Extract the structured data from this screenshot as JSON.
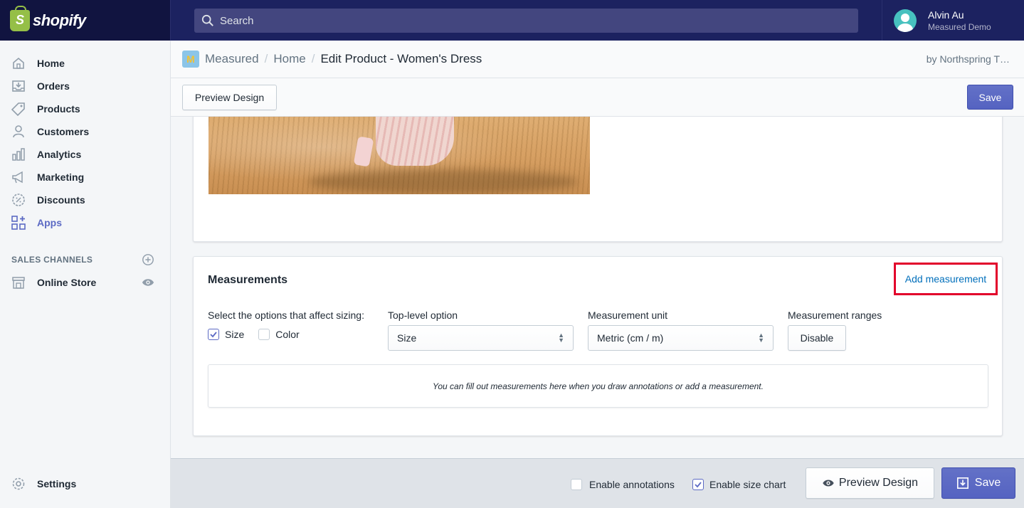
{
  "topbar": {
    "brand": "shopify",
    "search_placeholder": "Search",
    "user_name": "Alvin Au",
    "store_name": "Measured Demo"
  },
  "sidebar": {
    "items": [
      {
        "label": "Home",
        "icon": "home-icon"
      },
      {
        "label": "Orders",
        "icon": "orders-icon"
      },
      {
        "label": "Products",
        "icon": "tag-icon"
      },
      {
        "label": "Customers",
        "icon": "person-icon"
      },
      {
        "label": "Analytics",
        "icon": "bar-chart-icon"
      },
      {
        "label": "Marketing",
        "icon": "megaphone-icon"
      },
      {
        "label": "Discounts",
        "icon": "discount-icon"
      },
      {
        "label": "Apps",
        "icon": "apps-icon",
        "active": true
      }
    ],
    "sales_channels_header": "SALES CHANNELS",
    "online_store": "Online Store",
    "settings": "Settings"
  },
  "header": {
    "app_name": "Measured",
    "crumb_home": "Home",
    "crumb_current": "Edit Product - Women's Dress",
    "by_line": "by Northspring T…"
  },
  "toolbar": {
    "preview_label": "Preview Design",
    "save_label": "Save"
  },
  "measurements": {
    "title": "Measurements",
    "add_label": "Add measurement",
    "sizing_label": "Select the options that affect sizing:",
    "options": [
      {
        "label": "Size",
        "checked": true
      },
      {
        "label": "Color",
        "checked": false
      }
    ],
    "top_level_label": "Top-level option",
    "top_level_value": "Size",
    "unit_label": "Measurement unit",
    "unit_value": "Metric (cm / m)",
    "ranges_label": "Measurement ranges",
    "ranges_button": "Disable",
    "empty_text": "You can fill out measurements here when you draw annotations or add a measurement."
  },
  "footer": {
    "enable_annotations": "Enable annotations",
    "enable_annotations_checked": false,
    "enable_size_chart": "Enable size chart",
    "enable_size_chart_checked": true,
    "preview_label": "Preview Design",
    "save_label": "Save"
  },
  "colors": {
    "accent": "#5c6ac4",
    "topbar": "#1c2260",
    "highlight": "#e2002b",
    "link": "#006fbb"
  }
}
